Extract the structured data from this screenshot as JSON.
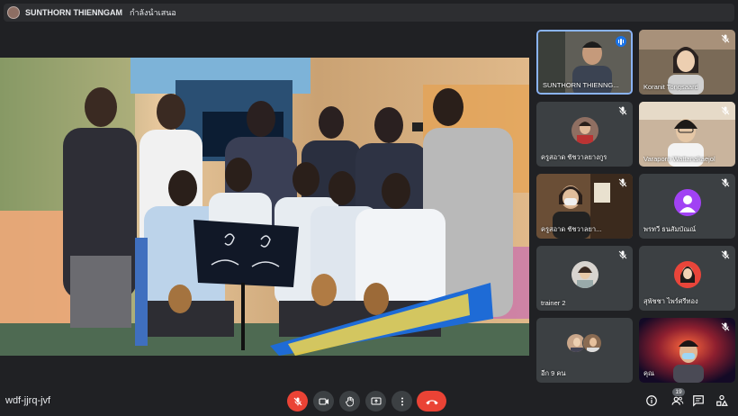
{
  "header": {
    "presenter_name": "SUNTHORN THIENNGAM",
    "presenter_status": "กำลังนำเสนอ"
  },
  "participants": [
    {
      "name": "SUNTHORN THIENNG...",
      "speaking": true
    },
    {
      "name": "Koranit Tongsaard",
      "muted": true
    },
    {
      "name": "ครูสอาด ชัชวาลยางกูร",
      "muted": true
    },
    {
      "name": "Varaporn Wattanakaejol",
      "muted": true
    },
    {
      "name": "ครูสอาด ชัชวาลยา...",
      "muted": true
    },
    {
      "name": "พรทวี ธนสัมบัณณ์",
      "muted": true,
      "avatar_color": "#a142f4"
    },
    {
      "name": "trainer 2",
      "muted": true
    },
    {
      "name": "สุพัชชา ไพร์ศรีทอง",
      "muted": true
    },
    {
      "name": "อีก 9 คน"
    },
    {
      "name": "คุณ",
      "muted": true
    }
  ],
  "footer": {
    "meeting_code": "wdf-jjrq-jvf",
    "people_count": "19"
  },
  "colors": {
    "accent": "#8ab4f8",
    "danger": "#ea4335",
    "control_bg": "#3c4043",
    "speaking": "#1a73e8"
  },
  "icons": [
    "mic-off-icon",
    "camera-icon",
    "raise-hand-icon",
    "present-icon",
    "more-icon",
    "end-call-icon",
    "info-icon",
    "people-icon",
    "chat-icon",
    "activities-icon"
  ]
}
